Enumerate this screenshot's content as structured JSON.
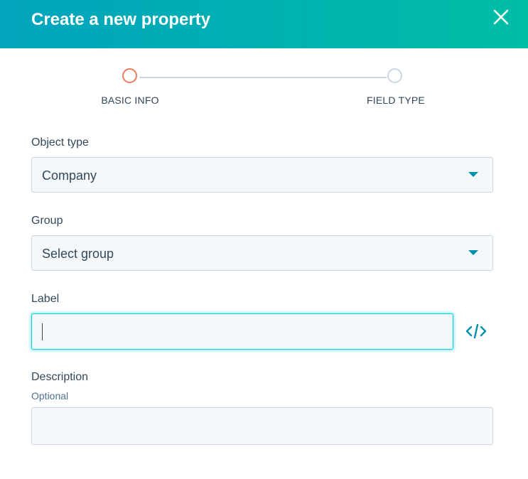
{
  "header": {
    "title": "Create a new property",
    "close_icon": "close-icon"
  },
  "stepper": {
    "steps": [
      {
        "label": "BASIC INFO",
        "state": "active"
      },
      {
        "label": "FIELD TYPE",
        "state": "inactive"
      }
    ]
  },
  "form": {
    "object_type": {
      "label": "Object type",
      "value": "Company"
    },
    "group": {
      "label": "Group",
      "value": "Select group"
    },
    "label_field": {
      "label": "Label",
      "value": "",
      "icon": "code-icon"
    },
    "description": {
      "label": "Description",
      "hint": "Optional",
      "value": ""
    }
  },
  "colors": {
    "header_start": "#00a4bd",
    "header_end": "#00bda5",
    "active_step": "#f2795d",
    "inactive_step": "#cbd6e2",
    "accent": "#0091ae",
    "focus_border": "#00d0e4",
    "text": "#33475b"
  }
}
